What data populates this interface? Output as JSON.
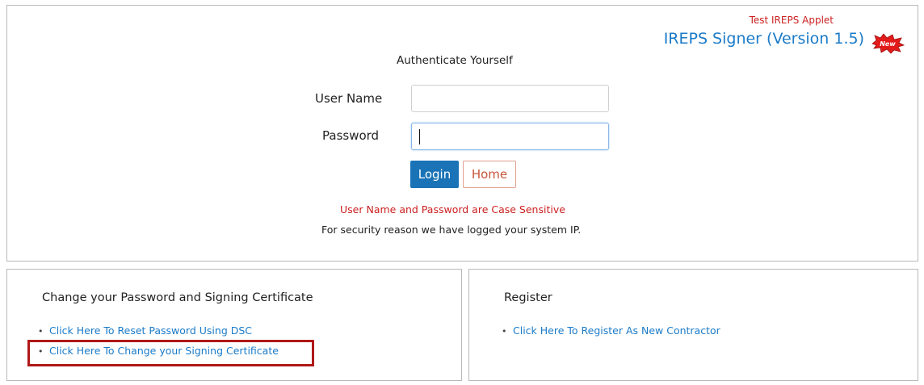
{
  "header": {
    "test_label": "Test IREPS Applet",
    "signer_title": "IREPS Signer (Version 1.5)",
    "new_badge": "New"
  },
  "login": {
    "heading": "Authenticate Yourself",
    "username_label": "User Name",
    "username_value": "",
    "password_label": "Password",
    "password_value": "",
    "login_button": "Login",
    "home_button": "Home",
    "case_note": "User Name and Password are Case Sensitive",
    "security_note": "For security reason we have logged your system IP."
  },
  "password_section": {
    "title": "Change your Password and Signing Certificate",
    "links": [
      "Click Here To Reset Password Using DSC",
      "Click Here To Change your Signing Certificate"
    ]
  },
  "register_section": {
    "title": "Register",
    "links": [
      "Click Here To Register As New Contractor"
    ]
  },
  "colors": {
    "link": "#1b7bc8",
    "alert": "#cc1f1f",
    "login_button_bg": "#1a73b7",
    "highlight": "#b01818"
  },
  "icons": {
    "new_badge": "new-starburst-icon",
    "bullet": "bullet-dot"
  }
}
